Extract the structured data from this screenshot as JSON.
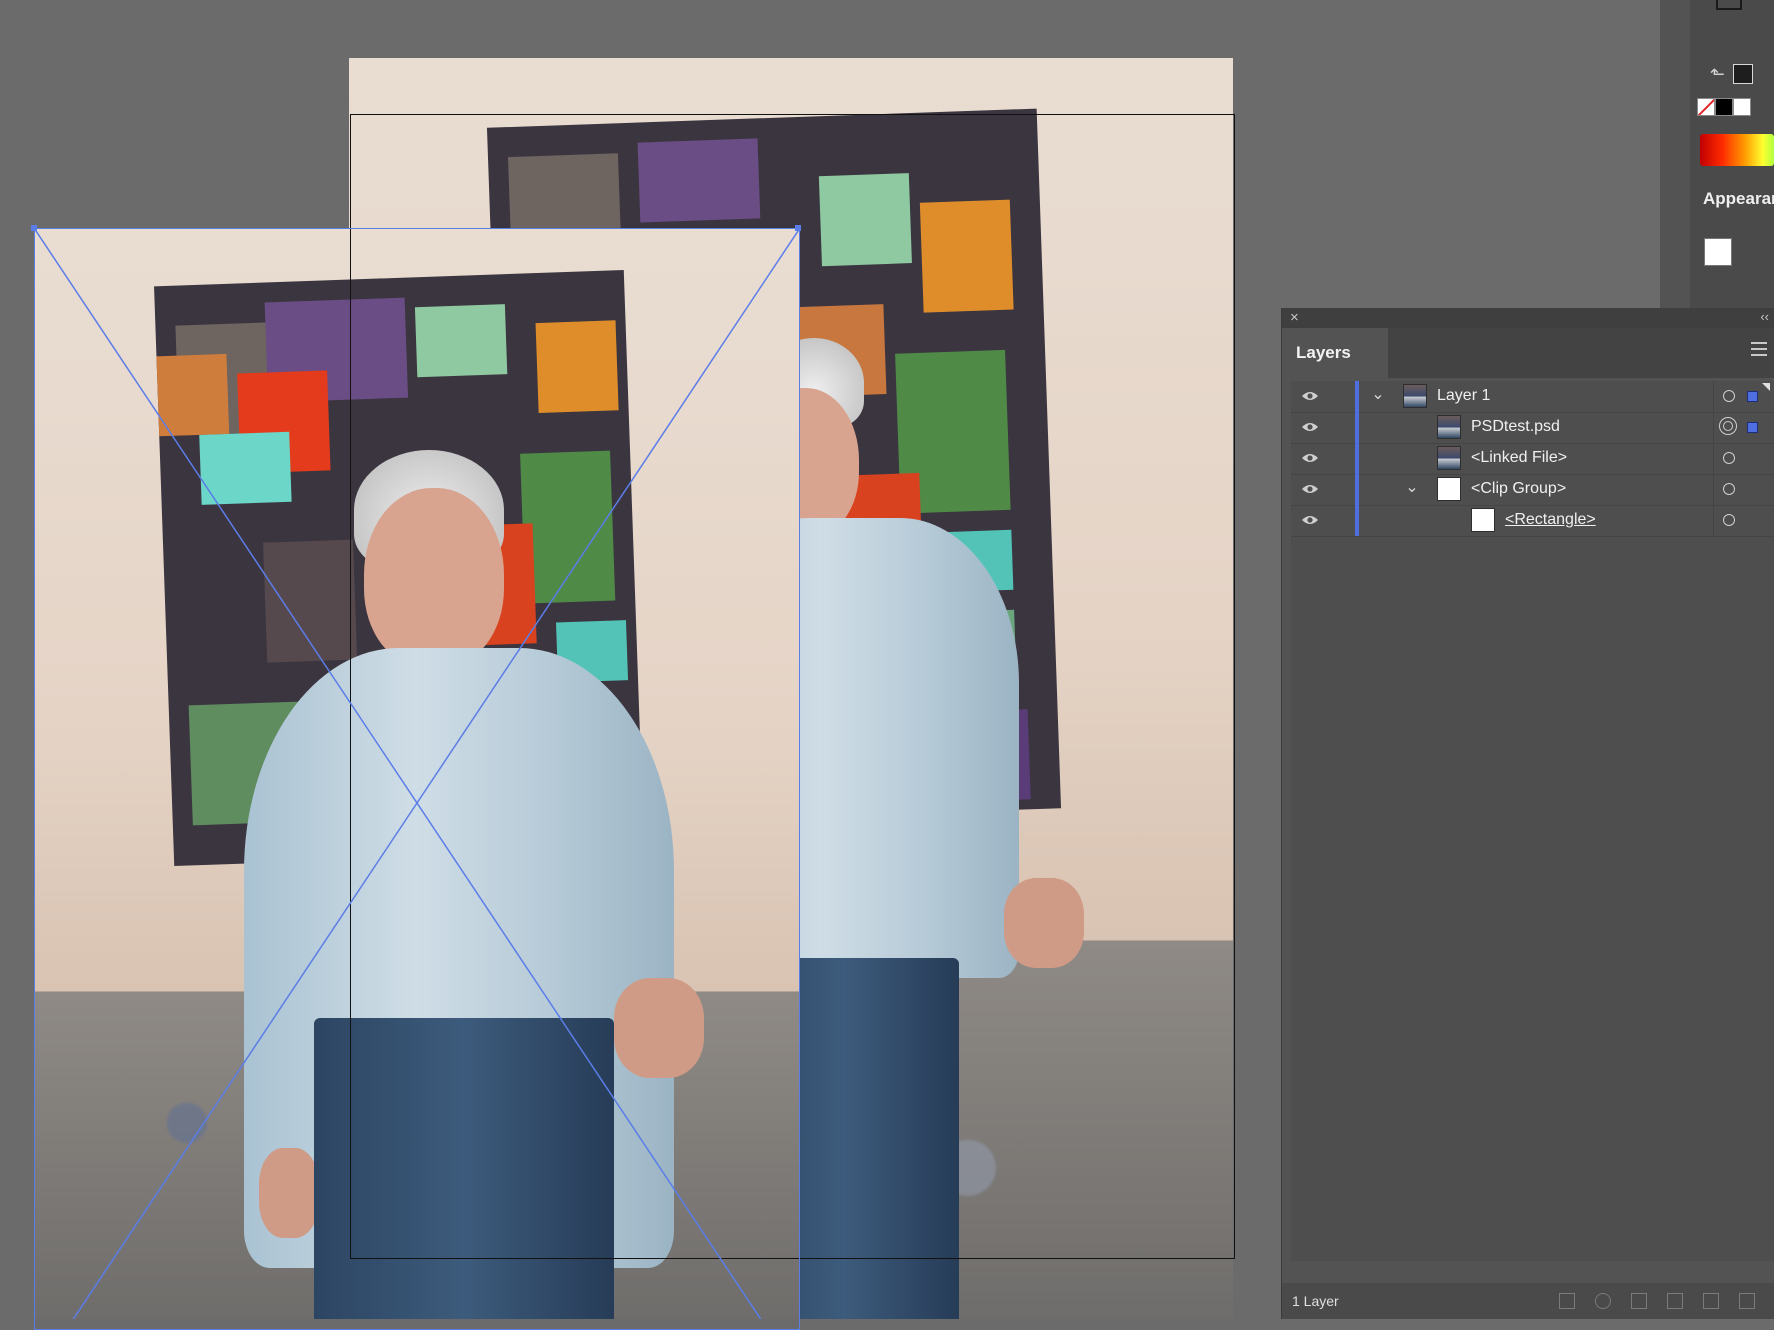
{
  "appearance_panel": {
    "title": "Appearar"
  },
  "layers_panel": {
    "tab_label": "Layers",
    "footer_count": "1 Layer",
    "layers": [
      {
        "name": "Layer 1",
        "expanded": true,
        "thumbnail": "photo",
        "target": "single",
        "selected_square": true,
        "underline": false
      },
      {
        "name": "PSDtest.psd",
        "thumbnail": "photo",
        "target": "double",
        "selected_square": true,
        "underline": false
      },
      {
        "name": "<Linked File>",
        "thumbnail": "photo",
        "target": "single",
        "selected_square": false,
        "underline": false
      },
      {
        "name": "<Clip Group>",
        "expanded": true,
        "thumbnail": "white",
        "target": "single",
        "selected_square": false,
        "underline": false
      },
      {
        "name": "<Rectangle>",
        "thumbnail": "white",
        "target": "single",
        "selected_square": false,
        "underline": true
      }
    ]
  },
  "colors": {
    "canvas_bg": "#6b6b6b",
    "selection_blue": "#5b7de8",
    "layer_color": "#4f6ee0"
  },
  "icons": {
    "eye": "visibility-eye-icon",
    "close": "close-icon",
    "collapse": "collapse-panel-icon",
    "menu": "panel-menu-icon",
    "chevron": "chevron-down-icon"
  }
}
